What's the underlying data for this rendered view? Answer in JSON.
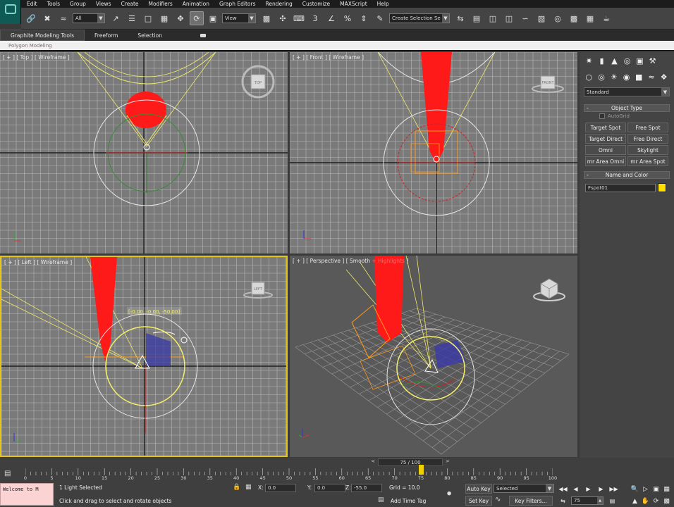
{
  "menu": {
    "items": [
      "Edit",
      "Tools",
      "Group",
      "Views",
      "Create",
      "Modifiers",
      "Animation",
      "Graph Editors",
      "Rendering",
      "Customize",
      "MAXScript",
      "Help"
    ]
  },
  "toolbar": {
    "selection_filter": "All",
    "reference_coord": "View",
    "named_selection": "Create Selection Se",
    "active_tool": "select-and-rotate"
  },
  "ribbon": {
    "tabs": [
      "Graphite Modeling Tools",
      "Freeform",
      "Selection"
    ],
    "sub_label": "Polygon Modeling"
  },
  "viewports": {
    "top": {
      "label": "[ + ] [ Top ] [ Wireframe ]"
    },
    "front": {
      "label": "[ + ] [ Front ] [ Wireframe ]"
    },
    "left": {
      "label": "[ + ] [ Left ] [ Wireframe ]",
      "rotate_readout": "[-0.00, -0.00, -50.00]"
    },
    "perspective": {
      "label_a": "[ + ] [ Perspective ] [ Smooth ",
      "label_b": "+ Highlights",
      "label_c": " ]"
    }
  },
  "viewcube": {
    "top": "TOP",
    "front": "FRONT",
    "left": "LEFT"
  },
  "command_panel": {
    "category": "Standard",
    "object_type": {
      "title": "Object Type",
      "autogrid": "AutoGrid",
      "buttons": [
        "Target Spot",
        "Free Spot",
        "Target Direct",
        "Free Direct",
        "Omni",
        "Skylight",
        "mr Area Omni",
        "mr Area Spot"
      ]
    },
    "name_color": {
      "title": "Name and Color",
      "name": "Fspot01",
      "color": "#ffe000"
    }
  },
  "timeline": {
    "frame_label": "75 / 100",
    "prev": "<",
    "next": ">",
    "current": 75,
    "labels": [
      "0",
      "5",
      "10",
      "15",
      "20",
      "25",
      "30",
      "35",
      "40",
      "45",
      "50",
      "55",
      "60",
      "65",
      "70",
      "75",
      "80",
      "85",
      "90",
      "95",
      "100"
    ]
  },
  "status": {
    "maxscript_listener": "Welcome to M",
    "selection_count": "1 Light Selected",
    "prompt": "Click and drag to select and rotate objects",
    "x_label": "X:",
    "x_value": "0.0",
    "y_label": "Y:",
    "y_value": "0.0",
    "z_label": "Z:",
    "z_value": "-55.0",
    "grid": "Grid = 10.0",
    "add_time_tag": "Add Time Tag"
  },
  "animation": {
    "auto_key": "Auto Key",
    "set_key": "Set Key",
    "selected": "Selected",
    "key_filters": "Key Filters...",
    "current_frame": "75"
  },
  "colors": {
    "spotlight_cone": "#ff1a1a",
    "light_gizmo": "#f5f06a",
    "active_viewport_border": "#e6c419",
    "target_box": "#ff9a1a"
  }
}
